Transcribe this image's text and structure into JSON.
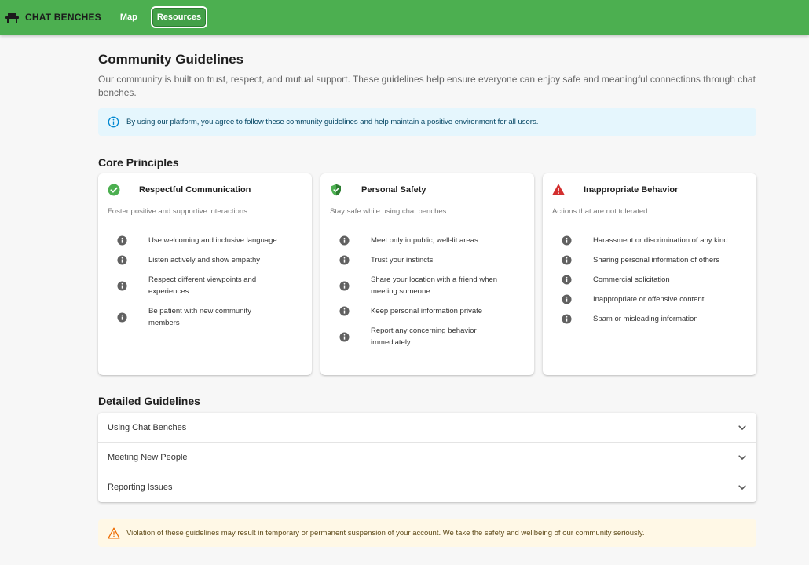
{
  "app": {
    "brand": "CHAT BENCHES",
    "nav": {
      "map": "Map",
      "resources": "Resources"
    }
  },
  "page": {
    "title": "Community Guidelines",
    "intro": "Our community is built on trust, respect, and mutual support. These guidelines help ensure everyone can enjoy safe and meaningful connections through chat benches.",
    "info_alert": "By using our platform, you agree to follow these community guidelines and help maintain a positive environment for all users."
  },
  "core": {
    "title": "Core Principles",
    "cards": [
      {
        "icon": "check-circle-icon",
        "color": "#4caf50",
        "title": "Respectful Communication",
        "subtitle": "Foster positive and supportive interactions",
        "items": [
          "Use welcoming and inclusive language",
          "Listen actively and show empathy",
          "Respect different viewpoints and experiences",
          "Be patient with new community members"
        ]
      },
      {
        "icon": "shield-icon",
        "color": "#4caf50",
        "title": "Personal Safety",
        "subtitle": "Stay safe while using chat benches",
        "items": [
          "Meet only in public, well-lit areas",
          "Trust your instincts",
          "Share your location with a friend when meeting someone",
          "Keep personal information private",
          "Report any concerning behavior immediately"
        ]
      },
      {
        "icon": "warning-icon",
        "color": "#d32f2f",
        "title": "Inappropriate Behavior",
        "subtitle": "Actions that are not tolerated",
        "items": [
          "Harassment or discrimination of any kind",
          "Sharing personal information of others",
          "Commercial solicitation",
          "Inappropriate or offensive content",
          "Spam or misleading information"
        ]
      }
    ]
  },
  "detailed": {
    "title": "Detailed Guidelines",
    "sections": [
      "Using Chat Benches",
      "Meeting New People",
      "Reporting Issues"
    ]
  },
  "warning_alert": "Violation of these guidelines may result in temporary or permanent suspension of your account. We take the safety and wellbeing of our community seriously.",
  "colors": {
    "appbar": "#4caf50",
    "info_bg": "#e5f6fd",
    "info_icon": "#0288d1",
    "warning_bg": "#fff8e6",
    "warning_icon": "#ed6c02",
    "item_icon": "#616161"
  }
}
